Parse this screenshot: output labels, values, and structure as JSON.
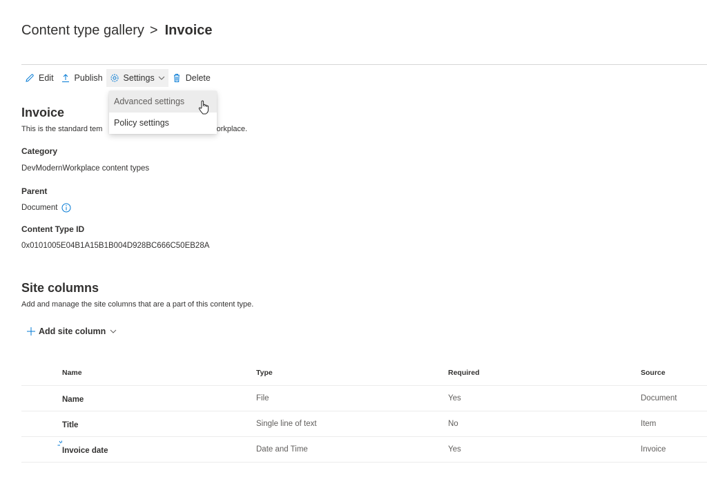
{
  "breadcrumb": {
    "parent": "Content type gallery",
    "separator": ">",
    "current": "Invoice"
  },
  "command_bar": {
    "edit": "Edit",
    "publish": "Publish",
    "settings": "Settings",
    "delete": "Delete"
  },
  "settings_menu": {
    "items": [
      {
        "label": "Advanced settings",
        "hovered": true
      },
      {
        "label": "Policy settings",
        "hovered": false
      }
    ]
  },
  "content_type": {
    "title": "Invoice",
    "description_visible_left": "This is the standard tem",
    "description_visible_right": "Workplace.",
    "fields": [
      {
        "label": "Category",
        "value": "DevModernWorkplace content types"
      },
      {
        "label": "Parent",
        "value": "Document",
        "info_icon": true
      },
      {
        "label": "Content Type ID",
        "value": "0x0101005E04B1A15B1B004D928BC666C50EB28A"
      }
    ]
  },
  "site_columns": {
    "title": "Site columns",
    "description": "Add and manage the site columns that are a part of this content type.",
    "add_button": "Add site column",
    "columns": [
      "Name",
      "Type",
      "Required",
      "Source"
    ],
    "rows": [
      {
        "name": "Name",
        "type": "File",
        "required": "Yes",
        "source": "Document"
      },
      {
        "name": "Title",
        "type": "Single line of text",
        "required": "No",
        "source": "Item"
      },
      {
        "name": "Invoice date",
        "type": "Date and Time",
        "required": "Yes",
        "source": "Invoice",
        "new_marker": true
      }
    ]
  },
  "colors": {
    "accent": "#0078d4",
    "text": "#323130",
    "text_secondary": "#605e5c",
    "divider": "#ececec",
    "menu_hover": "#ececec"
  }
}
